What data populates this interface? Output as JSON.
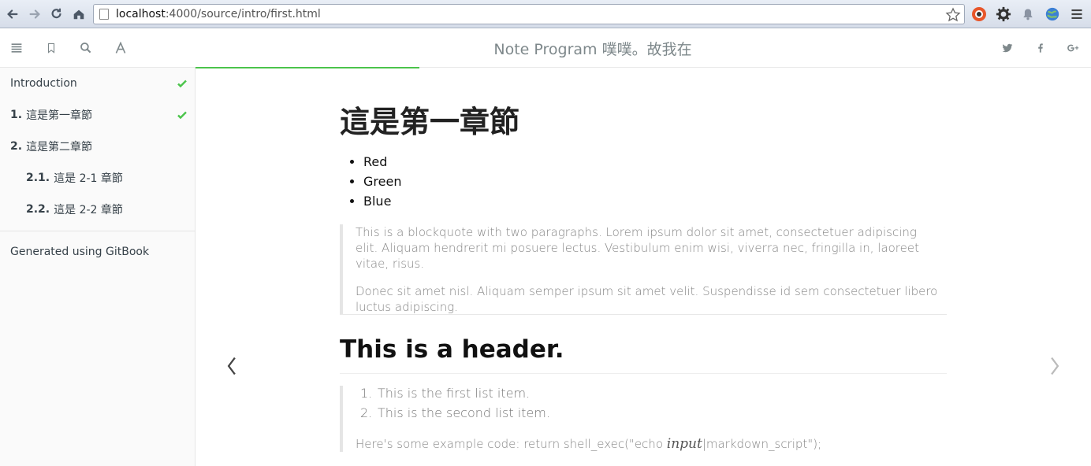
{
  "browser": {
    "url_host": "localhost",
    "url_path": ":4000/source/intro/first.html"
  },
  "header": {
    "title": "Note Program 噗噗。故我在"
  },
  "sidebar": {
    "items": [
      {
        "num": "",
        "label": "Introduction",
        "done": true
      },
      {
        "num": "1.",
        "label": "這是第一章節",
        "done": true
      },
      {
        "num": "2.",
        "label": "這是第二章節",
        "done": false
      },
      {
        "num": "2.1.",
        "label": "這是 2-1 章節",
        "done": false
      },
      {
        "num": "2.2.",
        "label": "這是 2-2 章節",
        "done": false
      }
    ],
    "generated": "Generated using GitBook"
  },
  "main": {
    "chapter_title": "這是第一章節",
    "colors": [
      "Red",
      "Green",
      "Blue"
    ],
    "blockquote_p1": "This is a blockquote with two paragraphs. Lorem ipsum dolor sit amet, consectetuer adipiscing elit. Aliquam hendrerit mi posuere lectus. Vestibulum enim wisi, viverra nec, fringilla in, laoreet vitae, risus.",
    "blockquote_p2": "Donec sit amet nisl. Aliquam semper ipsum sit amet velit. Suspendisse id sem consectetuer libero luctus adipiscing.",
    "header2": "This is a header.",
    "list": [
      {
        "n": "1.",
        "text": "This is the first list item."
      },
      {
        "n": "2.",
        "text": "This is the second list item."
      }
    ],
    "code_prefix": "Here's some example code: return shell_exec(\"echo ",
    "code_math": "input",
    "code_suffix": "|markdown_script\");"
  },
  "colors": {
    "accent": "#4bc44b",
    "sidebar_bg": "#fafafa",
    "title_gray": "#7e888b"
  }
}
